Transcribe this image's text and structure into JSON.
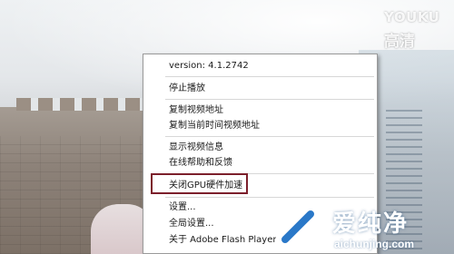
{
  "watermark": {
    "brand": "YOUKU",
    "subtitle": "高清"
  },
  "context_menu": {
    "items": [
      {
        "label": "version: 4.1.2742"
      },
      {
        "label": "停止播放"
      },
      {
        "label": "复制视频地址"
      },
      {
        "label": "复制当前时间视频地址"
      },
      {
        "label": "显示视频信息"
      },
      {
        "label": "在线帮助和反馈"
      },
      {
        "label": "关闭GPU硬件加速"
      },
      {
        "label": "设置..."
      },
      {
        "label": "全局设置..."
      },
      {
        "label": "关于 Adobe Flash Player"
      }
    ],
    "highlight_color": "#7c1f2b"
  },
  "logo": {
    "title": "爱纯净",
    "url": "aichunjing.com",
    "icon": "aichunjing-logo-icon"
  }
}
